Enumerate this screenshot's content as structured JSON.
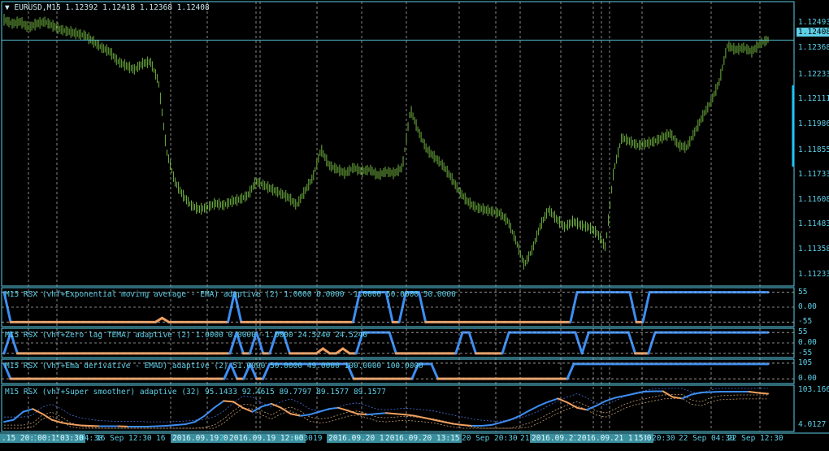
{
  "colors": {
    "background": "#000000",
    "grid": "#5dd0e8",
    "candles": "#6fb03f",
    "rsx_up": "#3d8ef2",
    "rsx_down": "#f0a060",
    "levels": "#b0b0b0",
    "super_bands": "#4a6fd4"
  },
  "header": {
    "title": "EURUSD,M15",
    "ohlc": "1.12392 1.12418 1.12368 1.12408"
  },
  "price_panel": {
    "current_price": "1.12408",
    "y_ticks": [
      "1.12493",
      "1.12368",
      "1.12233",
      "1.12111",
      "1.11986",
      "1.11855",
      "1.11733",
      "1.11608",
      "1.11483",
      "1.11358",
      "1.11233"
    ]
  },
  "indicator_panels": [
    {
      "title": "M15 RSX (vhf+Exponential moving average - EMA) adaptive (2) 1.0000 0.0000 -1.0000 50.0000 50.0000",
      "y_ticks": [
        "55",
        "0.00",
        "-55"
      ]
    },
    {
      "title": "M15 RSX (vhf+Zero lag TEMA) adaptive (2) 1.0000 0.0000 -1.0000 24.5240 24.5240",
      "y_ticks": [
        "55",
        "0.00",
        "-55"
      ]
    },
    {
      "title": "M15 RSX (vhf+Ema derivative - EMAD) adaptive (2) 51.0000 50.0000 49.0000 100.0000 100.0000",
      "y_ticks": [
        "105",
        "0.00"
      ]
    },
    {
      "title": "M15 RSX (vhf+Super smoother) adaptive (32) 95.1433 92.4615 89.7797 89.1577 89.1577",
      "y_ticks": [
        "103.1663",
        "4.0127"
      ]
    }
  ],
  "x_axis": {
    "ticks": [
      {
        "label": ".15 20:30",
        "hl": true
      },
      {
        "label": "00:15",
        "hl": true
      },
      {
        "label": "03:30",
        "hl": true
      },
      {
        "label": "04:30",
        "hl": false
      },
      {
        "label": "16 Sep 12:30",
        "hl": false
      },
      {
        "label": "16",
        "hl": false
      },
      {
        "label": "2016.09.19 0",
        "hl": true
      },
      {
        "label": "2",
        "hl": false
      },
      {
        "label": "2016.09.19 12:00",
        "hl": true
      },
      {
        "label": "2:30",
        "hl": false
      },
      {
        "label": "19 S",
        "hl": false
      },
      {
        "label": "2016.09.20 13:15",
        "hl": true
      },
      {
        "label": "2016.09.20 13:15",
        "hl": true
      },
      {
        "label": "20 Sep 20:30",
        "hl": false
      },
      {
        "label": "21",
        "hl": false
      },
      {
        "label": "2016.09.21",
        "hl": true
      },
      {
        "label": "2016.09.21 16:30",
        "hl": true
      },
      {
        "label": "15",
        "hl": true
      },
      {
        "label": "20:30",
        "hl": false
      },
      {
        "label": "22 Sep 04:30",
        "hl": false
      },
      {
        "label": "22 Sep 12:30",
        "hl": false
      }
    ]
  },
  "chart_data": [
    {
      "type": "candlestick",
      "title": "EURUSD,M15",
      "ylim": [
        1.112,
        1.1256
      ],
      "close": [
        1.1251,
        1.1249,
        1.125,
        1.1247,
        1.1249,
        1.125,
        1.1248,
        1.1246,
        1.1245,
        1.1244,
        1.1243,
        1.124,
        1.1237,
        1.1235,
        1.123,
        1.1228,
        1.1226,
        1.1229,
        1.123,
        1.122,
        1.1185,
        1.117,
        1.1163,
        1.1158,
        1.1156,
        1.1157,
        1.1159,
        1.1158,
        1.116,
        1.1161,
        1.1163,
        1.117,
        1.1168,
        1.1166,
        1.1164,
        1.1162,
        1.1158,
        1.1165,
        1.1172,
        1.1186,
        1.1178,
        1.1176,
        1.1174,
        1.1177,
        1.1175,
        1.1176,
        1.1173,
        1.1175,
        1.1174,
        1.1177,
        1.1206,
        1.1195,
        1.1186,
        1.1182,
        1.1178,
        1.1172,
        1.1165,
        1.116,
        1.1157,
        1.1156,
        1.1155,
        1.1154,
        1.115,
        1.114,
        1.1128,
        1.1136,
        1.1148,
        1.1156,
        1.1151,
        1.1147,
        1.115,
        1.1148,
        1.1147,
        1.1144,
        1.1137,
        1.1175,
        1.1192,
        1.119,
        1.1188,
        1.1189,
        1.119,
        1.1192,
        1.1194,
        1.1188,
        1.1187,
        1.1195,
        1.1203,
        1.121,
        1.122,
        1.1238,
        1.1236,
        1.1237,
        1.1235,
        1.1239,
        1.1241
      ]
    },
    {
      "type": "line",
      "name": "RSX EMA",
      "ylim": [
        -60,
        60
      ],
      "values": [
        55,
        -55,
        -55,
        -55,
        -55,
        -55,
        -55,
        -55,
        -55,
        -55,
        -55,
        -55,
        -55,
        -55,
        -55,
        -55,
        -55,
        -55,
        -55,
        -55,
        -55,
        -55,
        -55,
        -55,
        -40,
        -55,
        -55,
        -55,
        -55,
        -55,
        -55,
        -55,
        -55,
        -55,
        -55,
        55,
        -55,
        -55,
        -55,
        -55,
        -55,
        -55,
        -55,
        -55,
        -55,
        -55,
        -55,
        -55,
        -55,
        -55,
        -55,
        -55,
        -55,
        -55,
        55,
        55,
        55,
        55,
        55,
        -55,
        -55,
        55,
        55,
        55,
        -55,
        -55,
        -55,
        -55,
        -55,
        -55,
        -55,
        -55,
        -55,
        -55,
        -55,
        -55,
        -55,
        -55,
        -55,
        -55,
        -55,
        -55,
        -55,
        -55,
        -55,
        -55,
        -55,
        55,
        55,
        55,
        55,
        55,
        55,
        55,
        55,
        55,
        -55,
        -55,
        55,
        55,
        55,
        55,
        55,
        55,
        55,
        55,
        55,
        55,
        55,
        55,
        55,
        55,
        55,
        55,
        55,
        55,
        55
      ]
    },
    {
      "type": "line",
      "name": "RSX TEMA",
      "ylim": [
        -60,
        60
      ],
      "values": [
        -55,
        55,
        -55,
        -55,
        -55,
        -55,
        -55,
        -55,
        -55,
        -55,
        -55,
        -55,
        -55,
        -55,
        -55,
        -55,
        -55,
        -55,
        -55,
        -55,
        -55,
        -55,
        -55,
        -55,
        -55,
        -55,
        -55,
        -55,
        -55,
        -55,
        -55,
        -55,
        -55,
        -55,
        -55,
        55,
        -55,
        -55,
        55,
        -55,
        -55,
        55,
        55,
        -55,
        -55,
        -55,
        -55,
        -55,
        -30,
        -55,
        -55,
        -30,
        -55,
        -55,
        55,
        55,
        55,
        55,
        55,
        -55,
        -55,
        -55,
        -55,
        -55,
        -55,
        -55,
        -55,
        -55,
        -55,
        55,
        55,
        -55,
        -55,
        -55,
        -55,
        -55,
        55,
        55,
        55,
        55,
        55,
        55,
        55,
        55,
        55,
        55,
        55,
        -55,
        55,
        55,
        55,
        55,
        55,
        55,
        55,
        -55,
        -55,
        -55,
        55,
        55,
        55,
        55,
        55,
        55,
        55,
        55,
        55,
        55,
        55,
        55,
        55,
        55,
        55,
        55,
        55,
        55
      ]
    },
    {
      "type": "line",
      "name": "RSX EMAD",
      "ylim": [
        -10,
        110
      ],
      "values": [
        100,
        0,
        0,
        0,
        0,
        0,
        0,
        0,
        0,
        0,
        0,
        0,
        0,
        0,
        0,
        0,
        0,
        0,
        0,
        0,
        0,
        0,
        0,
        0,
        0,
        0,
        0,
        0,
        0,
        0,
        0,
        0,
        0,
        0,
        0,
        100,
        0,
        0,
        100,
        0,
        0,
        100,
        100,
        100,
        100,
        100,
        100,
        100,
        100,
        100,
        100,
        100,
        100,
        100,
        0,
        0,
        0,
        0,
        0,
        0,
        0,
        0,
        0,
        0,
        100,
        100,
        100,
        0,
        0,
        0,
        0,
        0,
        0,
        0,
        0,
        0,
        0,
        0,
        0,
        0,
        0,
        0,
        0,
        0,
        0,
        0,
        0,
        0,
        100,
        100,
        100,
        100,
        100,
        100,
        100,
        100,
        100,
        100,
        100,
        100,
        100,
        100,
        100,
        100,
        100,
        100,
        100,
        100,
        100,
        100,
        100,
        100,
        100,
        100,
        100,
        100,
        100,
        100,
        100
      ]
    },
    {
      "type": "line",
      "name": "RSX Super smoother",
      "ylim": [
        4.0127,
        103.1663
      ],
      "values": [
        20,
        25,
        45,
        52,
        40,
        25,
        18,
        14,
        11,
        10,
        9,
        9,
        9,
        8,
        8,
        8,
        9,
        10,
        12,
        14,
        20,
        35,
        55,
        72,
        70,
        55,
        45,
        58,
        65,
        55,
        40,
        35,
        38,
        45,
        52,
        55,
        48,
        40,
        38,
        40,
        42,
        40,
        38,
        35,
        30,
        25,
        20,
        15,
        12,
        10,
        10,
        12,
        18,
        25,
        35,
        48,
        60,
        70,
        78,
        68,
        55,
        50,
        60,
        72,
        80,
        85,
        90,
        95,
        96,
        96,
        82,
        78,
        88,
        93,
        94,
        95,
        95,
        95,
        95,
        92,
        90
      ]
    }
  ]
}
